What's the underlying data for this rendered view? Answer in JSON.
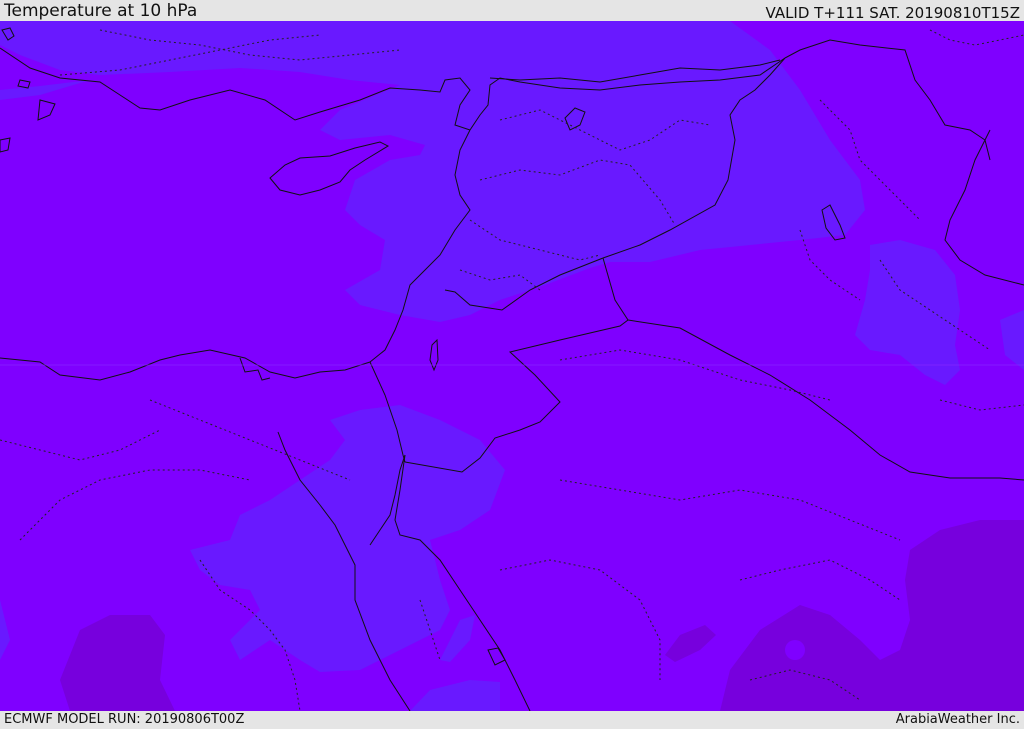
{
  "header": {
    "title": "Temperature at 10 hPa",
    "valid": "VALID T+111 SAT. 20190810T15Z"
  },
  "footer": {
    "model_run": "ECMWF MODEL RUN: 20190806T00Z",
    "credit": "ArabiaWeather Inc."
  },
  "map": {
    "colors": {
      "base": "#7f00ff",
      "warm_zone": "#6919ff",
      "cold_zone": "#7700dd",
      "border": "#111111"
    }
  }
}
